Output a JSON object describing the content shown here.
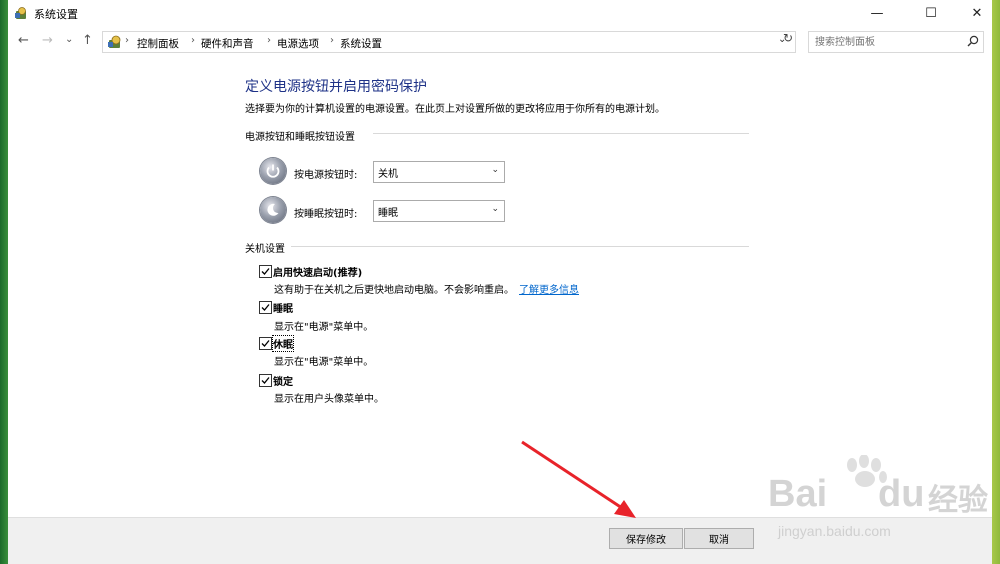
{
  "window": {
    "title": "系统设置",
    "minimize": "—",
    "maximize": "☐",
    "close": "✕"
  },
  "nav": {
    "back": "←",
    "forward": "→",
    "recent": "⌄",
    "up": "↑"
  },
  "breadcrumb": [
    {
      "label": "控制面板"
    },
    {
      "label": "硬件和声音"
    },
    {
      "label": "电源选项"
    },
    {
      "label": "系统设置"
    }
  ],
  "breadcrumb_sep": "›",
  "address": {
    "dropdown": "⌄",
    "refresh": "↻"
  },
  "search": {
    "placeholder": "搜索控制面板"
  },
  "page": {
    "heading": "定义电源按钮并启用密码保护",
    "description": "选择要为你的计算机设置的电源设置。在此页上对设置所做的更改将应用于你所有的电源计划。"
  },
  "power_section": {
    "title": "电源按钮和睡眠按钮设置",
    "power_button": {
      "label": "按电源按钮时:",
      "value": "关机"
    },
    "sleep_button": {
      "label": "按睡眠按钮时:",
      "value": "睡眠"
    }
  },
  "shutdown_section": {
    "title": "关机设置",
    "options": [
      {
        "label": "启用快速启动(推荐)",
        "desc": "这有助于在关机之后更快地启动电脑。不会影响重启。",
        "link": "了解更多信息",
        "checked": true
      },
      {
        "label": "睡眠",
        "desc": "显示在\"电源\"菜单中。",
        "checked": true
      },
      {
        "label": "休眠",
        "desc": "显示在\"电源\"菜单中。",
        "checked": true
      },
      {
        "label": "锁定",
        "desc": "显示在用户头像菜单中。",
        "checked": true
      }
    ]
  },
  "footer": {
    "save": "保存修改",
    "cancel": "取消"
  },
  "watermark": {
    "line1": "Bai",
    "line1b": "du",
    "cn": "经验",
    "url": "jingyan.baidu.com"
  },
  "colors": {
    "heading": "#1e3287",
    "link": "#0066cc",
    "arrow": "#e8232a",
    "footer_bg": "#f0f0f0"
  }
}
